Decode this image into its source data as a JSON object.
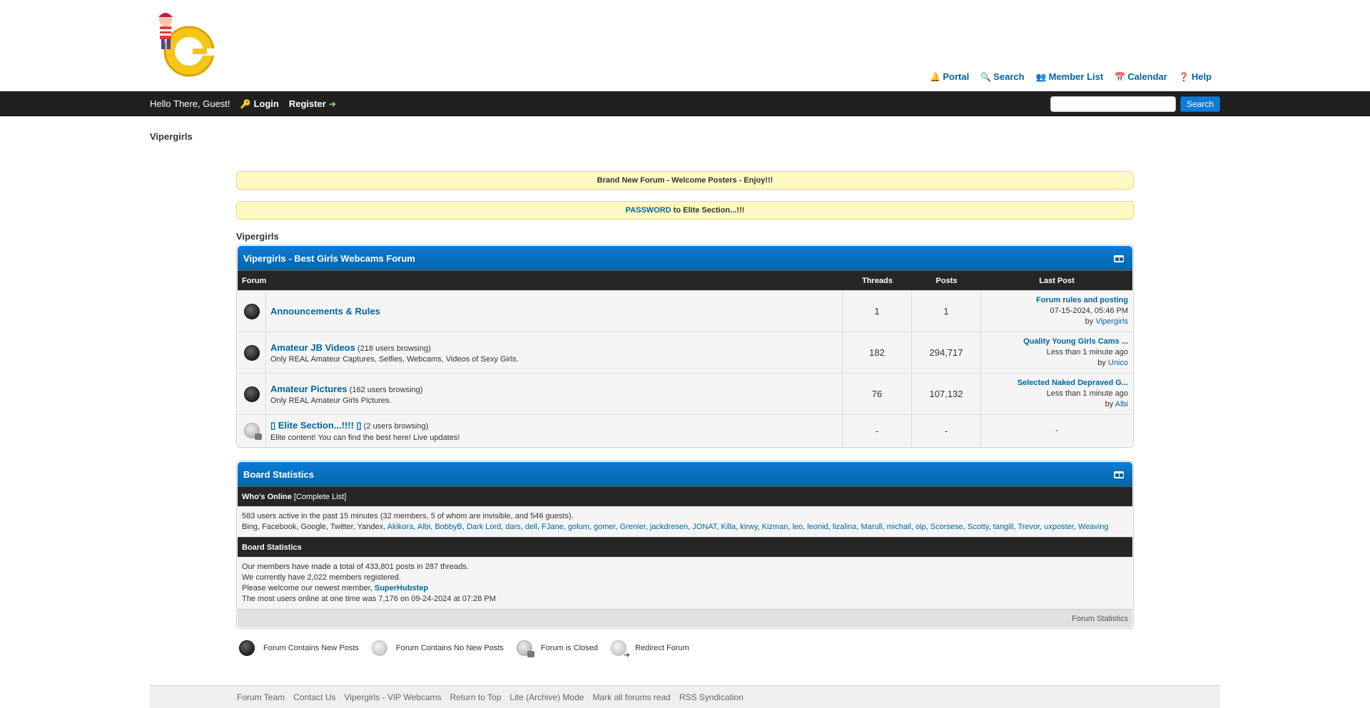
{
  "header": {
    "menu": [
      {
        "label": "Portal",
        "icon": "portal-icon",
        "glyph": "🔔"
      },
      {
        "label": "Search",
        "icon": "search-icon",
        "glyph": "🔍"
      },
      {
        "label": "Member List",
        "icon": "members-icon",
        "glyph": "👥"
      },
      {
        "label": "Calendar",
        "icon": "calendar-icon",
        "glyph": "📅"
      },
      {
        "label": "Help",
        "icon": "help-icon",
        "glyph": "❓"
      }
    ]
  },
  "topbar": {
    "greeting": "Hello There, Guest!",
    "login": "Login",
    "register": "Register",
    "search_button": "Search",
    "search_value": ""
  },
  "breadcrumb": "Vipergirls",
  "notices": {
    "welcome": "Brand New Forum - Welcome Posters - Enjoy!!!",
    "password_link": "PASSWORD",
    "password_rest": " to Elite Section...!!!"
  },
  "category": {
    "crumb": "Vipergirls",
    "title": "Vipergirls - Best Girls Webcams Forum",
    "columns": {
      "forum": "Forum",
      "threads": "Threads",
      "posts": "Posts",
      "last_post": "Last Post"
    },
    "forums": [
      {
        "title": "Announcements & Rules",
        "browsing": "",
        "desc": "",
        "threads": "1",
        "posts": "1",
        "lp_title": "Forum rules and posting",
        "lp_time": "07-15-2024, 05:46 PM",
        "lp_by": "by ",
        "lp_user": "Vipergirls"
      },
      {
        "title": "Amateur JB Videos",
        "browsing": " (218 users browsing)",
        "desc": "Only REAL Amateur Captures, Selfies, Webcams, Videos of Sexy Girls.",
        "threads": "182",
        "posts": "294,717",
        "lp_title": "Quality Young Girls Cams ...",
        "lp_time": "Less than 1 minute ago",
        "lp_by": "by ",
        "lp_user": "Unico"
      },
      {
        "title": "Amateur Pictures",
        "browsing": " (162 users browsing)",
        "desc": "Only REAL Amateur Girls Pictures.",
        "threads": "76",
        "posts": "107,132",
        "lp_title": "Selected Naked Depraved G...",
        "lp_time": "Less than 1 minute ago",
        "lp_by": "by ",
        "lp_user": "Albi"
      },
      {
        "title": "▯ Elite Section...!!!! ▯",
        "browsing": " (2 users browsing)",
        "desc": "Elite content! You can find the best here! Live updates!",
        "threads": "-",
        "posts": "-",
        "lp_empty": "-"
      }
    ]
  },
  "stats": {
    "title": "Board Statistics",
    "whos_online": "Who's Online",
    "complete_list": "[Complete List]",
    "active_line": "583 users active in the past 15 minutes (32 members, 5 of whom are invisible, and 546 guests).",
    "bots": "Bing, Facebook, Google, Twitter, Yandex, ",
    "online_users": [
      "Akikora",
      "Albi",
      "BobbyB",
      "Dark Lord",
      "dars",
      "dell",
      "FJane",
      "golum",
      "gomer",
      "Grenier",
      "jackdresen",
      "JONAT",
      "Killa",
      "kirwy",
      "Kizman",
      "leo",
      "leonid",
      "lizalina",
      "Marull",
      "michail",
      "oip",
      "Scorsese",
      "Scotty",
      "tangill",
      "Trevor",
      "uxposter",
      "Weaving"
    ],
    "board_stats_header": "Board Statistics",
    "line1": "Our members have made a total of 433,801 posts in 287 threads.",
    "line2": "We currently have 2,022 members registered.",
    "line3": "Please welcome our newest member, ",
    "newest_member": "SuperHubstep",
    "line4": "The most users online at one time was 7,176 on 09-24-2024 at 07:28 PM",
    "footer": "Forum Statistics"
  },
  "legend": {
    "new_posts": "Forum Contains New Posts",
    "no_new_posts": "Forum Contains No New Posts",
    "closed": "Forum is Closed",
    "redirect": "Redirect Forum"
  },
  "footer_links": [
    "Forum Team",
    "Contact Us",
    "Vipergirls - VIP Webcams",
    "Return to Top",
    "Lite (Archive) Mode",
    "Mark all forums read",
    "RSS Syndication"
  ]
}
